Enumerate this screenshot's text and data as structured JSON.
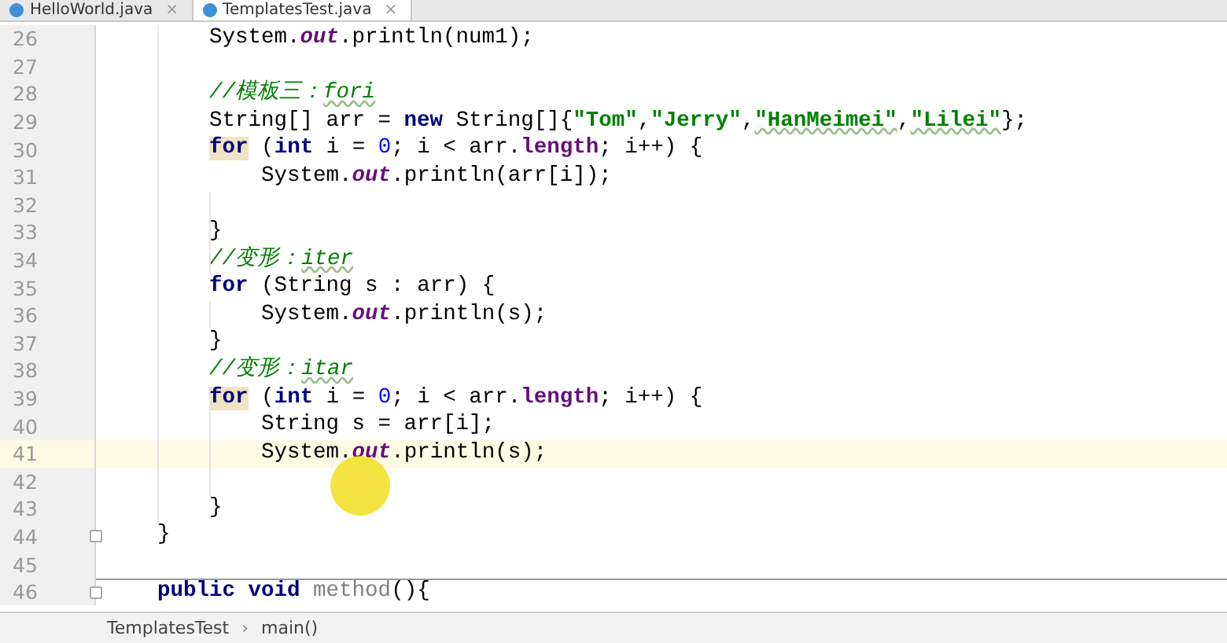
{
  "tabs": [
    {
      "label": "HelloWorld.java",
      "close": "×",
      "selected": false
    },
    {
      "label": "TemplatesTest.java",
      "close": "×",
      "selected": true
    }
  ],
  "editor": {
    "lines": [
      {
        "number": "26",
        "current": false,
        "fold": false,
        "separator": false,
        "tokens": [
          {
            "t": "        System.",
            "kind": "plain"
          },
          {
            "t": "out",
            "kind": "field"
          },
          {
            "t": ".println(num1);",
            "kind": "plain"
          }
        ]
      },
      {
        "number": "27",
        "current": false,
        "fold": false,
        "separator": false
      },
      {
        "number": "28",
        "current": false,
        "fold": false,
        "separator": false,
        "tokens": [
          {
            "t": "        //模板三：",
            "kind": "comment"
          },
          {
            "t": "fori",
            "kind": "comment",
            "typo": true
          }
        ]
      },
      {
        "number": "29",
        "current": false,
        "fold": false,
        "separator": false,
        "tokens": [
          {
            "t": "        String[] arr = ",
            "kind": "plain"
          },
          {
            "t": "new",
            "kind": "keyword"
          },
          {
            "t": " String[]{",
            "kind": "plain"
          },
          {
            "t": "\"Tom\"",
            "kind": "string"
          },
          {
            "t": ",",
            "kind": "plain"
          },
          {
            "t": "\"Jerry\"",
            "kind": "string"
          },
          {
            "t": ",",
            "kind": "plain"
          },
          {
            "t": "\"HanMeimei\"",
            "kind": "string",
            "typo": true
          },
          {
            "t": ",",
            "kind": "plain"
          },
          {
            "t": "\"Lilei\"",
            "kind": "string",
            "typo": true
          },
          {
            "t": "};",
            "kind": "plain"
          }
        ]
      },
      {
        "number": "30",
        "current": false,
        "fold": false,
        "separator": false,
        "tokens": [
          {
            "t": "        for",
            "kind": "keyword",
            "highlighted": true
          },
          {
            "t": " (",
            "kind": "plain"
          },
          {
            "t": "int",
            "kind": "keyword"
          },
          {
            "t": " i = ",
            "kind": "plain"
          },
          {
            "t": "0",
            "kind": "number"
          },
          {
            "t": "; i < arr.",
            "kind": "plain"
          },
          {
            "t": "length",
            "kind": "member"
          },
          {
            "t": "; i++) {",
            "kind": "plain"
          }
        ]
      },
      {
        "number": "31",
        "current": false,
        "fold": false,
        "separator": false,
        "tokens": [
          {
            "t": "            System.",
            "kind": "plain"
          },
          {
            "t": "out",
            "kind": "field"
          },
          {
            "t": ".println(arr[i]);",
            "kind": "plain"
          }
        ]
      },
      {
        "number": "32",
        "current": false,
        "fold": false,
        "separator": false
      },
      {
        "number": "33",
        "current": false,
        "fold": false,
        "separator": false,
        "tokens": [
          {
            "t": "        }",
            "kind": "plain"
          }
        ]
      },
      {
        "number": "34",
        "current": false,
        "fold": false,
        "separator": false,
        "tokens": [
          {
            "t": "        //变形：",
            "kind": "comment"
          },
          {
            "t": "iter",
            "kind": "comment",
            "typo": true
          }
        ]
      },
      {
        "number": "35",
        "current": false,
        "fold": false,
        "separator": false,
        "tokens": [
          {
            "t": "        for",
            "kind": "keyword"
          },
          {
            "t": " (String s : arr) {",
            "kind": "plain"
          }
        ]
      },
      {
        "number": "36",
        "current": false,
        "fold": false,
        "separator": false,
        "tokens": [
          {
            "t": "            System.",
            "kind": "plain"
          },
          {
            "t": "out",
            "kind": "field"
          },
          {
            "t": ".println(s);",
            "kind": "plain"
          }
        ]
      },
      {
        "number": "37",
        "current": false,
        "fold": false,
        "separator": false,
        "tokens": [
          {
            "t": "        }",
            "kind": "plain"
          }
        ]
      },
      {
        "number": "38",
        "current": false,
        "fold": false,
        "separator": false,
        "tokens": [
          {
            "t": "        //变形：",
            "kind": "comment"
          },
          {
            "t": "itar",
            "kind": "comment",
            "typo": true
          }
        ]
      },
      {
        "number": "39",
        "current": false,
        "fold": false,
        "separator": false,
        "tokens": [
          {
            "t": "        for",
            "kind": "keyword",
            "highlighted": true
          },
          {
            "t": " (",
            "kind": "plain"
          },
          {
            "t": "int",
            "kind": "keyword"
          },
          {
            "t": " i = ",
            "kind": "plain"
          },
          {
            "t": "0",
            "kind": "number"
          },
          {
            "t": "; i < arr.",
            "kind": "plain"
          },
          {
            "t": "length",
            "kind": "member"
          },
          {
            "t": "; i++) {",
            "kind": "plain"
          }
        ]
      },
      {
        "number": "40",
        "current": false,
        "fold": false,
        "separator": false,
        "tokens": [
          {
            "t": "            String s = arr[i];",
            "kind": "plain"
          }
        ]
      },
      {
        "number": "41",
        "current": true,
        "fold": false,
        "separator": false,
        "tokens": [
          {
            "t": "            System.",
            "kind": "plain"
          },
          {
            "t": "out",
            "kind": "field"
          },
          {
            "t": ".println(s);",
            "kind": "plain"
          }
        ]
      },
      {
        "number": "42",
        "current": false,
        "fold": false,
        "separator": false
      },
      {
        "number": "43",
        "current": false,
        "fold": false,
        "separator": false,
        "tokens": [
          {
            "t": "        }",
            "kind": "plain"
          }
        ]
      },
      {
        "number": "44",
        "current": false,
        "fold": true,
        "separator": false,
        "tokens": [
          {
            "t": "    }",
            "kind": "plain"
          }
        ]
      },
      {
        "number": "45",
        "current": false,
        "fold": false,
        "separator": false
      },
      {
        "number": "46",
        "current": false,
        "fold": true,
        "separator": true,
        "tokens": [
          {
            "t": "    public void",
            "kind": "keyword"
          },
          {
            "t": " method",
            "kind": "unused"
          },
          {
            "t": "(){",
            "kind": "plain"
          }
        ]
      }
    ]
  },
  "breadcrumb": [
    {
      "label": "TemplatesTest"
    },
    {
      "label": "main()"
    }
  ],
  "breadcrumb_separator": "›"
}
